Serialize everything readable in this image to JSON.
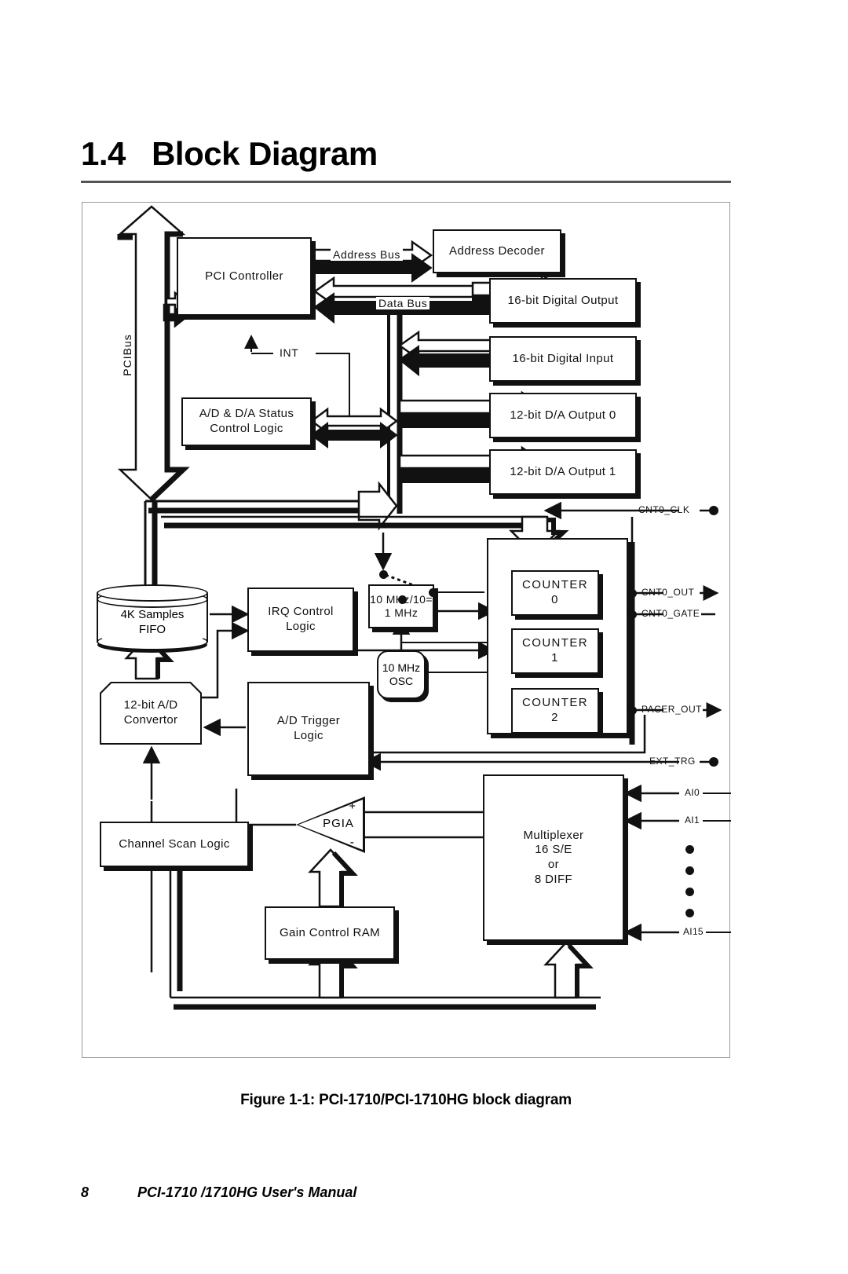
{
  "heading": {
    "number": "1.4",
    "title": "Block Diagram"
  },
  "figure": {
    "caption": "Figure 1-1: PCI-1710/PCI-1710HG block diagram"
  },
  "footer": {
    "page_number": "8",
    "manual_title": "PCI-1710 /1710HG  User's Manual"
  },
  "diagram": {
    "bus_labels": {
      "pci_bus": "PCIBus",
      "address_bus": "Address Bus",
      "data_bus": "Data Bus",
      "int": "INT"
    },
    "blocks": {
      "pci_controller": "PCI Controller",
      "address_decoder": "Address Decoder",
      "digital_output": "16-bit Digital Output",
      "digital_input": "16-bit Digital Input",
      "da_output_0": "12-bit D/A Output 0",
      "da_output_1": "12-bit D/A Output 1",
      "status_control_line1": "A/D & D/A Status",
      "status_control_line2": "Control Logic",
      "fifo_line1": "4K Samples",
      "fifo_line2": "FIFO",
      "irq_control_line1": "IRQ Control",
      "irq_control_line2": "Logic",
      "clock_divider_line1": "10 MHz/10=",
      "clock_divider_line2": "1 MHz",
      "oscillator_line1": "10 MHz",
      "oscillator_line2": "OSC",
      "ad_convertor_line1": "12-bit A/D",
      "ad_convertor_line2": "Convertor",
      "ad_trigger_line1": "A/D Trigger",
      "ad_trigger_line2": "Logic",
      "counter_0_line1": "COUNTER",
      "counter_0_line2": "0",
      "counter_1_line1": "COUNTER",
      "counter_1_line2": "1",
      "counter_2_line1": "COUNTER",
      "counter_2_line2": "2",
      "channel_scan_logic": "Channel Scan Logic",
      "gain_control_ram": "Gain Control RAM",
      "pgia": "PGIA",
      "pgia_plus": "+",
      "pgia_minus": "-",
      "multiplexer_line1": "Multiplexer",
      "multiplexer_line2": "16 S/E",
      "multiplexer_line3": "or",
      "multiplexer_line4": "8 DIFF"
    },
    "signals": {
      "cnt0_clk": "CNT0_CLK",
      "cnt0_out": "CNT0_OUT",
      "cnt0_gate": "CNT0_GATE",
      "pacer_out": "PACER_OUT",
      "ext_trg": "EXT_TRG",
      "ai0": "AI0",
      "ai1": "AI1",
      "ai15": "AI15"
    }
  },
  "colors": {
    "ink": "#111111",
    "rule": "#555555",
    "frame": "#999999",
    "paper": "#ffffff"
  }
}
